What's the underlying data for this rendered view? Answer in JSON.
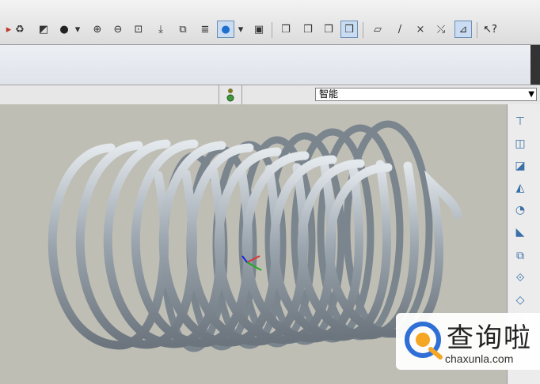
{
  "toolbar": {
    "icons": [
      "regen-icon",
      "model-tree-icon",
      "layer-icon",
      "shading-icon",
      "dropdown-icon",
      "zoom-in-icon",
      "zoom-out-icon",
      "refit-icon",
      "reorient-icon",
      "saved-views-icon",
      "layers-icon",
      "display-style-icon",
      "dropdown-icon",
      "snapshot-icon",
      "wireframe-icon",
      "hidden-line-icon",
      "no-hidden-icon",
      "shaded-icon",
      "datum-planes-icon",
      "datum-axes-icon",
      "datum-points-icon",
      "csys-icon",
      "spin-center-icon",
      "whats-this-icon"
    ]
  },
  "filterbar": {
    "filter_value": "智能"
  },
  "watermark": {
    "title": "查询啦",
    "url": "chaxunla.com"
  },
  "colors": {
    "viewport_bg": "#bfbeb5",
    "spring": "#9aa4ad"
  }
}
